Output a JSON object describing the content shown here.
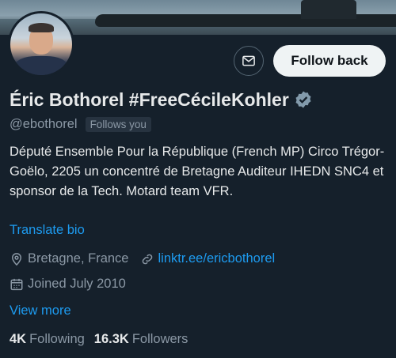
{
  "profile": {
    "name": "Éric Bothorel #FreeCécileKohler",
    "handle": "@ebothorel",
    "follows_you": "Follows you",
    "bio": "Député Ensemble Pour la République (French MP) Circo Trégor-Goëlo, 2205 un concentré de Bretagne Auditeur IHEDN SNC4 et sponsor de la Tech. Motard team VFR.",
    "translate_label": "Translate bio",
    "location": "Bretagne, France",
    "link": "linktr.ee/ericbothorel",
    "joined": "Joined July 2010",
    "view_more": "View more"
  },
  "actions": {
    "follow_back_label": "Follow back",
    "message_icon": "mail-icon"
  },
  "stats": {
    "following_count": "4K",
    "following_label": "Following",
    "followers_count": "16.3K",
    "followers_label": "Followers"
  },
  "colors": {
    "background": "#15202b",
    "accent": "#1d9bf0",
    "secondary_text": "#8b98a5",
    "verified_badge": "#829aab"
  }
}
